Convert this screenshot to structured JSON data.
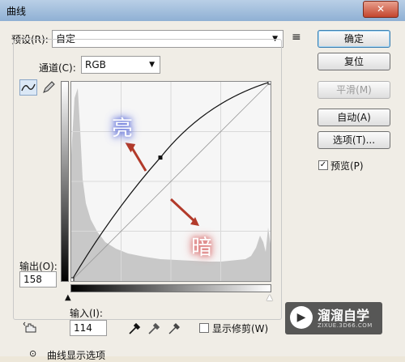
{
  "window": {
    "title": "曲线",
    "close_glyph": "✕"
  },
  "preset": {
    "label": "预设(R):",
    "value": "自定",
    "menu_glyph": "≡"
  },
  "channel": {
    "label": "通道(C):",
    "value": "RGB"
  },
  "buttons": {
    "ok": "确定",
    "reset": "复位",
    "smooth": "平滑(M)",
    "auto": "自动(A)",
    "options": "选项(T)...",
    "preview": "预览(P)"
  },
  "preview_checked": true,
  "output": {
    "label": "输出(O):",
    "value": "158"
  },
  "input": {
    "label": "输入(I):",
    "value": "114"
  },
  "show_clipping": {
    "label": "显示修剪(W)",
    "checked": false
  },
  "curve_display": {
    "label": "曲线显示选项"
  },
  "annotations": {
    "bright": "亮",
    "dark": "暗"
  },
  "watermark": {
    "cn": "溜溜自学",
    "en": "ZIXUE.3D66.COM",
    "logo_glyph": "▶"
  },
  "curve_point": {
    "input": 114,
    "output": 158
  },
  "colors": {
    "arrow": "#b23a2a",
    "bright_glow": "#5a6ad8",
    "dark_glow": "#d86a6a",
    "accent": "#3c7fb1"
  },
  "icons": [
    "curve-edit-icon",
    "pencil-icon",
    "hand-adjust-icon",
    "black-eyedropper-icon",
    "gray-eyedropper-icon",
    "white-eyedropper-icon"
  ]
}
